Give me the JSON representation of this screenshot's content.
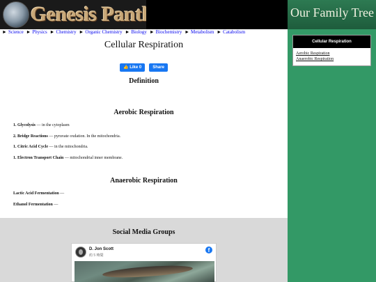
{
  "header": {
    "logo_text": "Genesis Panthesis",
    "family_tree_label": "Our Family Tree"
  },
  "breadcrumb": [
    "Science",
    "Physics",
    "Chemistry",
    "Organic Chemistry",
    "Biology",
    "Biochemistry",
    "Metabolism",
    "Catabolism"
  ],
  "breadcrumb_separator": "►",
  "page_title": "Cellular Respiration",
  "facebook": {
    "like_label": "👍 Like 0",
    "share_label": "Share"
  },
  "sections": {
    "definition": "Definition",
    "aerobic": "Aerobic Respiration",
    "anaerobic": "Anaerobic Respiration"
  },
  "aerobic_steps": [
    {
      "name": "1. Glycolysis",
      "desc": " — in the cytoplasm"
    },
    {
      "name": "2. Bridge Reactions",
      "desc": " — pyruvate oxdation. In the mitochondria."
    },
    {
      "name": "1. Citric Acid Cycle",
      "desc": " — in the mitochondria."
    },
    {
      "name": "1. Electron Transport Chain",
      "desc": " — mitochondrial inner membrane."
    }
  ],
  "anaerobic_steps": [
    {
      "name": "Lactic Acid Fermentation",
      "desc": " —"
    },
    {
      "name": "Ethanol Fermentation",
      "desc": " —"
    }
  ],
  "social": {
    "title": "Social Media Groups",
    "card_name": "D. Jon Scott",
    "card_sub": "約 5 時間",
    "fb_glyph": "f"
  },
  "sidebar": {
    "title": "Cellular Respiration",
    "links": [
      "Aerobic Respiration",
      "Anaerobic Respiration"
    ]
  },
  "colors": {
    "sidebar_green": "#339966",
    "fb_blue": "#1877f2",
    "link_blue": "#0000ee"
  }
}
